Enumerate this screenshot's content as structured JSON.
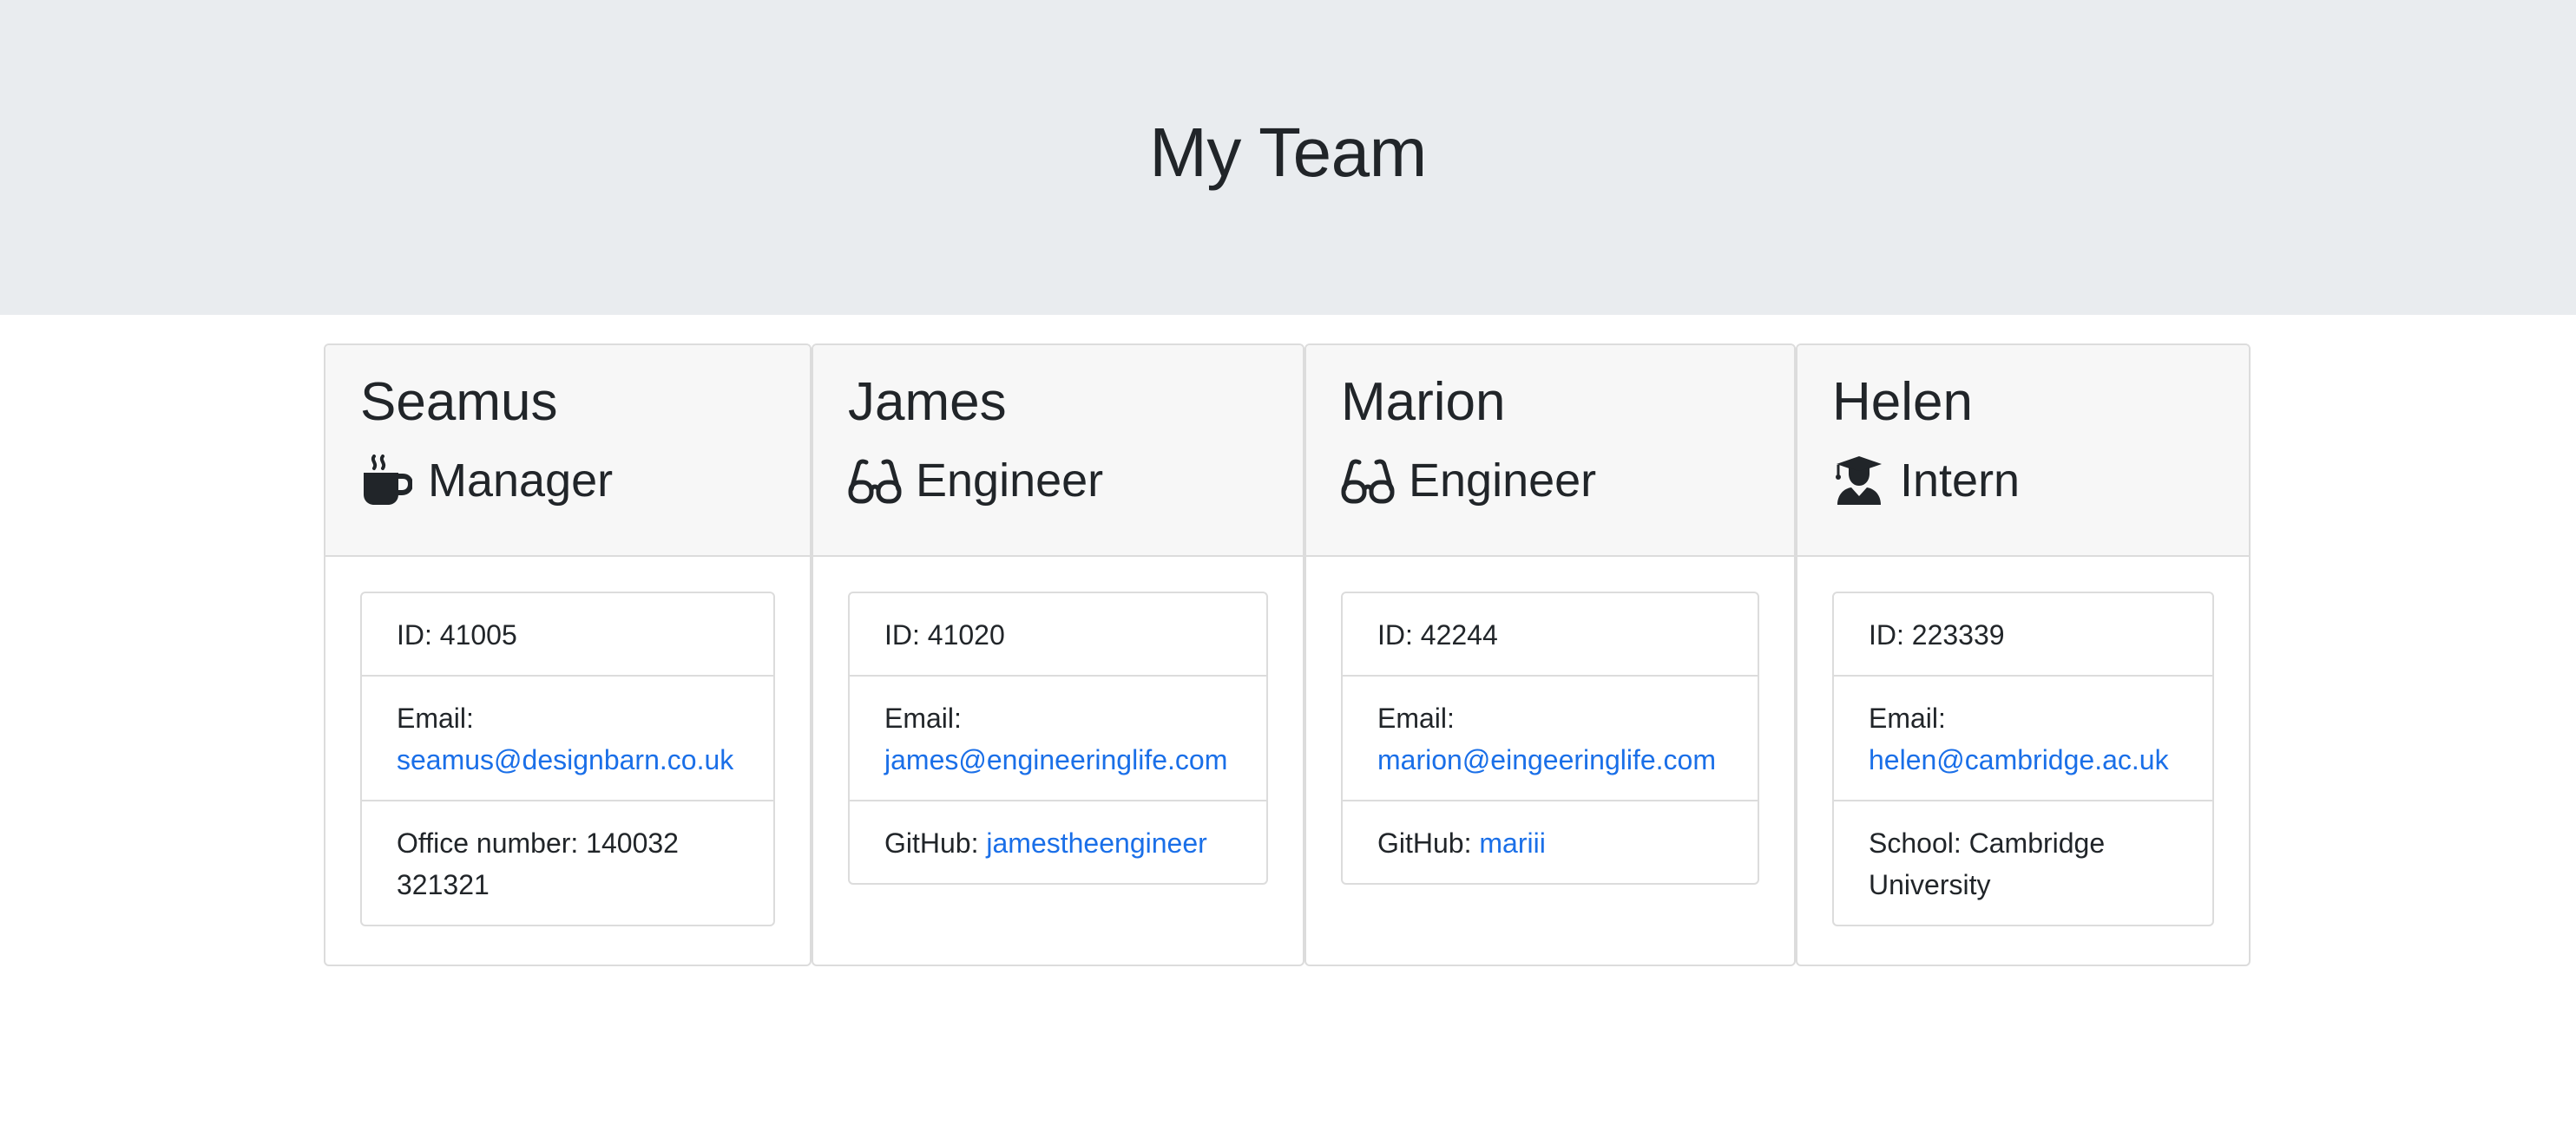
{
  "header": {
    "title": "My Team"
  },
  "colors": {
    "jumbotron": "#e9ecef",
    "link": "#1a6fe8",
    "text": "#212529",
    "card_header": "#f7f7f7",
    "border": "#dcdcdc"
  },
  "team": [
    {
      "name": "Seamus",
      "role": "Manager",
      "icon": "coffee-mug-icon",
      "id_label": "ID: 41005",
      "email_label": "Email:",
      "email": "seamus@designbarn.co.uk",
      "extra_label": "Office number: 140032 321321",
      "extra_value": ""
    },
    {
      "name": "James",
      "role": "Engineer",
      "icon": "glasses-icon",
      "id_label": "ID: 41020",
      "email_label": "Email:",
      "email": "james@engineeringlife.com",
      "extra_label": "GitHub:",
      "extra_value": "jamestheengineer"
    },
    {
      "name": "Marion",
      "role": "Engineer",
      "icon": "glasses-icon",
      "id_label": "ID: 42244",
      "email_label": "Email:",
      "email": "marion@eingeeringlife.com",
      "extra_label": "GitHub:",
      "extra_value": "mariii"
    },
    {
      "name": "Helen",
      "role": "Intern",
      "icon": "graduate-icon",
      "id_label": "ID: 223339",
      "email_label": "Email:",
      "email": "helen@cambridge.ac.uk",
      "extra_label": "School: Cambridge University",
      "extra_value": ""
    }
  ]
}
